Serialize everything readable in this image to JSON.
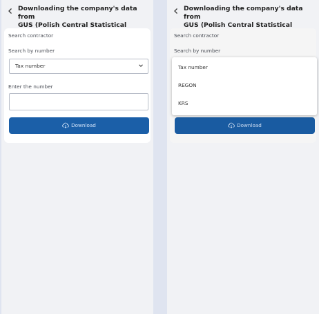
{
  "screens": [
    {
      "header": {
        "back_icon": "chevron-left-icon",
        "title_line1": "Downloading the company's data from",
        "title_line2": "GUS (Polish Central Statistical Office)"
      },
      "card": {
        "section_label": "Search contractor",
        "search_by_label": "Search by number",
        "select_value": "Tax number",
        "enter_label": "Enter the number",
        "number_input": {
          "value": "",
          "placeholder": ""
        },
        "download_label": "Download",
        "download_icon": "cloud-download-icon"
      }
    },
    {
      "header": {
        "back_icon": "chevron-left-icon",
        "title_line1": "Downloading the company's data from",
        "title_line2": "GUS (Polish Central Statistical Office)"
      },
      "card": {
        "section_label": "Search contractor",
        "search_by_label": "Search by number",
        "download_label": "Download",
        "download_icon": "cloud-download-icon"
      },
      "dropdown": {
        "options": [
          "Tax number",
          "REGON",
          "KRS"
        ]
      }
    }
  ],
  "colors": {
    "background": "#dfe4f0",
    "screen": "#f1f2f5",
    "card": "#ffffff",
    "accent": "#1b5fa8",
    "button_text": "#d6e6fb"
  }
}
